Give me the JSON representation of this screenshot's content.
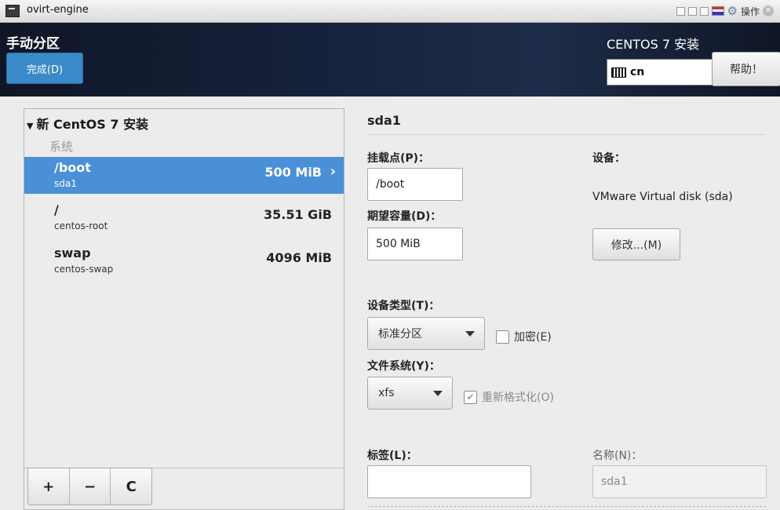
{
  "window": {
    "title": "ovirt-engine",
    "actions_label": "操作"
  },
  "header": {
    "page_title": "手动分区",
    "done_label": "完成(D)",
    "product_title": "CENTOS 7 安装",
    "keyboard_layout": "cn",
    "help_label": "帮助！"
  },
  "tree": {
    "root_label": "新 CentOS 7 安装",
    "group_label": "系统",
    "partitions": [
      {
        "mount": "/boot",
        "device": "sda1",
        "size": "500 MiB",
        "selected": true
      },
      {
        "mount": "/",
        "device": "centos-root",
        "size": "35.51 GiB",
        "selected": false
      },
      {
        "mount": "swap",
        "device": "centos-swap",
        "size": "4096 MiB",
        "selected": false
      }
    ],
    "toolbar": {
      "add": "+",
      "remove": "−",
      "reload": "C"
    }
  },
  "detail": {
    "title": "sda1",
    "mount_point_label": "挂载点(P)：",
    "mount_point_value": "/boot",
    "capacity_label": "期望容量(D)：",
    "capacity_value": "500 MiB",
    "device_label": "设备：",
    "device_value": "VMware Virtual disk (sda)",
    "modify_label": "修改...(M)",
    "device_type_label": "设备类型(T)：",
    "device_type_value": "标准分区",
    "encrypt_label": "加密(E)",
    "encrypt_checked": false,
    "filesystem_label": "文件系统(Y)：",
    "filesystem_value": "xfs",
    "reformat_label": "重新格式化(O)",
    "reformat_checked": true,
    "tag_label": "标签(L)：",
    "tag_value": "",
    "name_label": "名称(N)：",
    "name_value": "sda1"
  }
}
